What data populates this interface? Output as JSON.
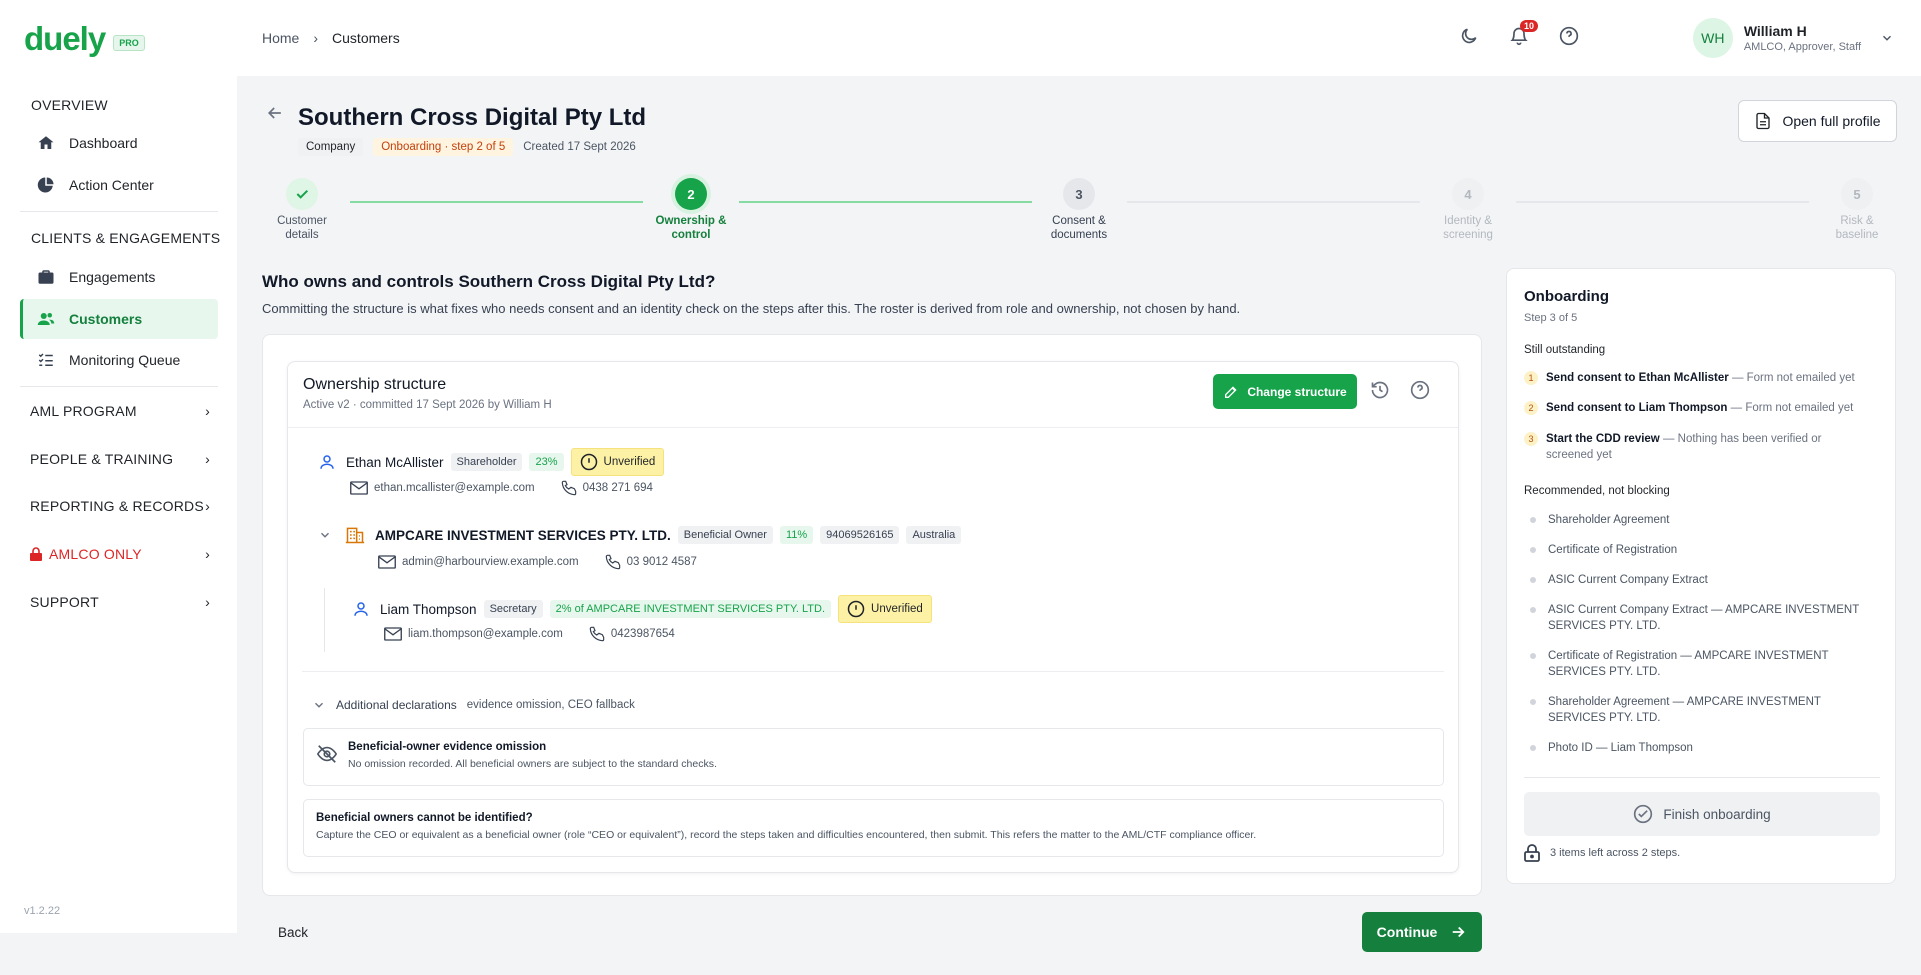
{
  "brand": {
    "name": "duely",
    "badge": "PRO"
  },
  "sidebar": {
    "overview_label": "OVERVIEW",
    "dashboard": "Dashboard",
    "action_center": "Action Center",
    "clients_label": "CLIENTS & ENGAGEMENTS",
    "engagements": "Engagements",
    "customers": "Customers",
    "monitoring_queue": "Monitoring Queue",
    "groups": [
      "AML PROGRAM",
      "PEOPLE & TRAINING",
      "REPORTING & RECORDS",
      "AMLCO ONLY",
      "SUPPORT"
    ],
    "version": "v1.2.22"
  },
  "breadcrumb": {
    "home": "Home",
    "current": "Customers"
  },
  "topbar": {
    "notification_count": "10"
  },
  "user": {
    "initials": "WH",
    "name": "William H",
    "roles": "AMLCO, Approver, Staff"
  },
  "header": {
    "title": "Southern Cross Digital Pty Ltd",
    "type_tag": "Company",
    "status_tag": "Onboarding · step 2 of 5",
    "created": "Created 17 Sept 2026",
    "open_profile": "Open full profile"
  },
  "stepper": [
    {
      "num": "",
      "label1": "Customer",
      "label2": "details",
      "state": "done"
    },
    {
      "num": "2",
      "label1": "Ownership &",
      "label2": "control",
      "state": "current"
    },
    {
      "num": "3",
      "label1": "Consent &",
      "label2": "documents",
      "state": "pending"
    },
    {
      "num": "4",
      "label1": "Identity &",
      "label2": "screening",
      "state": "future"
    },
    {
      "num": "5",
      "label1": "Risk &",
      "label2": "baseline",
      "state": "future"
    }
  ],
  "question": {
    "title": "Who owns and controls Southern Cross Digital Pty Ltd?",
    "desc": "Committing the structure is what fixes who needs consent and an identity check on the steps after this. The roster is derived from role and ownership, not chosen by hand."
  },
  "structure": {
    "title": "Ownership structure",
    "subtitle": "Active v2 · committed 17 Sept 2026 by William H",
    "change_button": "Change structure",
    "members": [
      {
        "name": "Ethan McAllister",
        "role": "Shareholder",
        "share": "23%",
        "status": "Unverified",
        "email": "ethan.mcallister@example.com",
        "phone": "0438 271 694"
      },
      {
        "name": "AMPCARE INVESTMENT SERVICES PTY. LTD.",
        "role": "Beneficial Owner",
        "share": "11%",
        "abn": "94069526165",
        "country": "Australia",
        "email": "admin@harbourview.example.com",
        "phone": "03 9012 4587"
      },
      {
        "name": "Liam Thompson",
        "role": "Secretary",
        "share": "2% of AMPCARE INVESTMENT SERVICES PTY. LTD.",
        "status": "Unverified",
        "email": "liam.thompson@example.com",
        "phone": "0423987654"
      }
    ],
    "additional_label": "Additional declarations",
    "additional_detail": "evidence omission, CEO fallback",
    "omission_title": "Beneficial-owner evidence omission",
    "omission_desc": "No omission recorded. All beneficial owners are subject to the standard checks.",
    "fallback_title": "Beneficial owners cannot be identified?",
    "fallback_desc": "Capture the CEO or equivalent as a beneficial owner (role “CEO or equivalent”), record the steps taken and difficulties encountered, then submit. This refers the matter to the AML/CTF compliance officer."
  },
  "footer": {
    "back": "Back",
    "continue": "Continue"
  },
  "panel": {
    "title": "Onboarding",
    "step": "Step 3 of 5",
    "outstanding_label": "Still outstanding",
    "outstanding": [
      {
        "num": "1",
        "bold": "Send consent to Ethan McAllister",
        "rest": " — Form not emailed yet"
      },
      {
        "num": "2",
        "bold": "Send consent to Liam Thompson",
        "rest": " — Form not emailed yet"
      },
      {
        "num": "3",
        "bold": "Start the CDD review",
        "rest": " — Nothing has been verified or screened yet"
      }
    ],
    "recommended_label": "Recommended, not blocking",
    "recommended": [
      "Shareholder Agreement",
      "Certificate of Registration",
      "ASIC Current Company Extract",
      "ASIC Current Company Extract — AMPCARE INVESTMENT SERVICES PTY. LTD.",
      "Certificate of Registration — AMPCARE INVESTMENT SERVICES PTY. LTD.",
      "Shareholder Agreement — AMPCARE INVESTMENT SERVICES PTY. LTD.",
      "Photo ID — Liam Thompson"
    ],
    "finish": "Finish onboarding",
    "foot": "3 items left across 2 steps."
  },
  "colors": {
    "brand": "#16a34a",
    "brand_dark": "#15803d",
    "warning": "#fdf1a6",
    "danger": "#dc2626"
  }
}
